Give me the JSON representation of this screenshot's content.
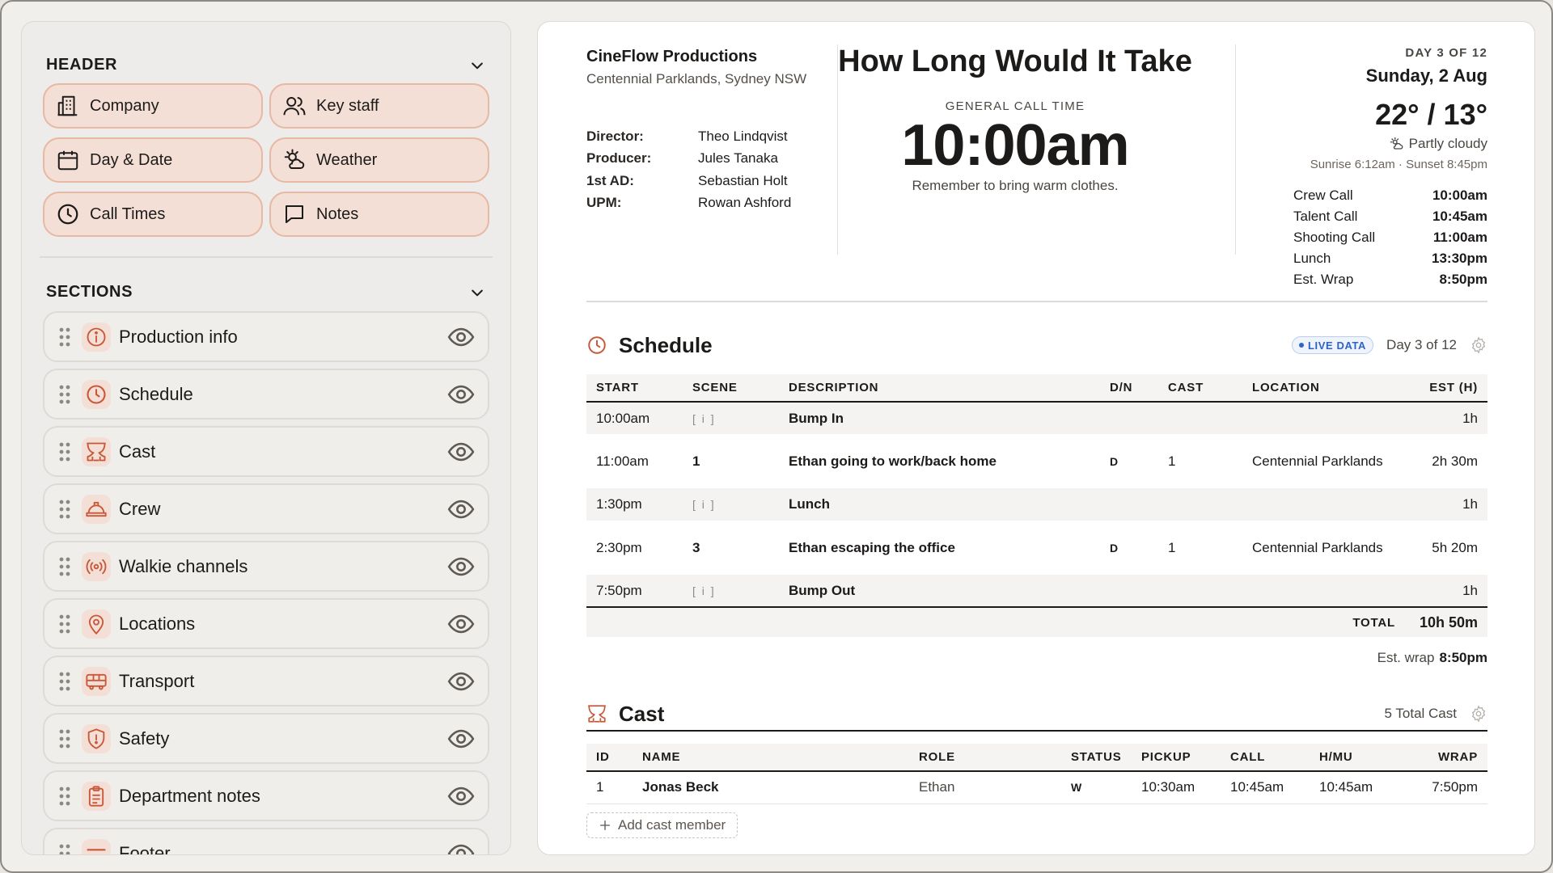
{
  "sidebar": {
    "header_title": "HEADER",
    "header_chips": [
      {
        "label": "Company",
        "icon": "building-icon"
      },
      {
        "label": "Key staff",
        "icon": "users-icon"
      },
      {
        "label": "Day & Date",
        "icon": "calendar-icon"
      },
      {
        "label": "Weather",
        "icon": "weather-icon"
      },
      {
        "label": "Call Times",
        "icon": "clock-icon"
      },
      {
        "label": "Notes",
        "icon": "message-icon"
      }
    ],
    "sections_title": "SECTIONS",
    "sections": [
      {
        "label": "Production info",
        "icon": "info-icon"
      },
      {
        "label": "Schedule",
        "icon": "clock-icon"
      },
      {
        "label": "Cast",
        "icon": "theater-icon"
      },
      {
        "label": "Crew",
        "icon": "hardhat-icon"
      },
      {
        "label": "Walkie channels",
        "icon": "radio-icon"
      },
      {
        "label": "Locations",
        "icon": "map-pin-icon"
      },
      {
        "label": "Transport",
        "icon": "bus-icon"
      },
      {
        "label": "Safety",
        "icon": "shield-icon"
      },
      {
        "label": "Department notes",
        "icon": "clipboard-icon"
      },
      {
        "label": "Footer",
        "icon": "footer-icon"
      }
    ]
  },
  "doc": {
    "company": "CineFlow Productions",
    "company_location": "Centennial Parklands, Sydney NSW",
    "staff": [
      {
        "role": "Director:",
        "name": "Theo Lindqvist"
      },
      {
        "role": "Producer:",
        "name": "Jules Tanaka"
      },
      {
        "role": "1st AD:",
        "name": "Sebastian Holt"
      },
      {
        "role": "UPM:",
        "name": "Rowan Ashford"
      }
    ],
    "title": "How Long Would It Take",
    "general_call_label": "GENERAL CALL TIME",
    "general_call_time": "10:00am",
    "general_call_note": "Remember to bring warm clothes.",
    "day_of": "DAY 3 OF 12",
    "date": "Sunday, 2 Aug",
    "temperature": "22° / 13°",
    "conditions": "Partly cloudy",
    "sun": "Sunrise 6:12am · Sunset 8:45pm",
    "call_times": [
      {
        "label": "Crew Call",
        "time": "10:00am"
      },
      {
        "label": "Talent Call",
        "time": "10:45am"
      },
      {
        "label": "Shooting Call",
        "time": "11:00am"
      },
      {
        "label": "Lunch",
        "time": "13:30pm"
      },
      {
        "label": "Est. Wrap",
        "time": "8:50pm"
      }
    ]
  },
  "schedule": {
    "title": "Schedule",
    "live_label": "LIVE DATA",
    "day_label": "Day 3 of 12",
    "columns": [
      "START",
      "SCENE",
      "DESCRIPTION",
      "D/N",
      "CAST",
      "LOCATION",
      "EST (H)"
    ],
    "rows": [
      {
        "start": "10:00am",
        "scene": "[ i ]",
        "desc": "Bump In",
        "dn": "",
        "cast": "",
        "location": "",
        "est": "1h",
        "kind": "gray"
      },
      {
        "start": "11:00am",
        "scene": "1",
        "desc": "Ethan going to work/back home",
        "dn": "D",
        "cast": "1",
        "location": "Centennial Parklands",
        "est": "2h 30m",
        "kind": "white"
      },
      {
        "start": "1:30pm",
        "scene": "[ i ]",
        "desc": "Lunch",
        "dn": "",
        "cast": "",
        "location": "",
        "est": "1h",
        "kind": "gray"
      },
      {
        "start": "2:30pm",
        "scene": "3",
        "desc": "Ethan escaping the office",
        "dn": "D",
        "cast": "1",
        "location": "Centennial Parklands",
        "est": "5h 20m",
        "kind": "white"
      },
      {
        "start": "7:50pm",
        "scene": "[ i ]",
        "desc": "Bump Out",
        "dn": "",
        "cast": "",
        "location": "",
        "est": "1h",
        "kind": "gray"
      }
    ],
    "total_label": "TOTAL",
    "total_value": "10h 50m",
    "est_wrap_label": "Est. wrap",
    "est_wrap_value": "8:50pm"
  },
  "cast": {
    "title": "Cast",
    "total_label": "5 Total Cast",
    "columns": [
      "ID",
      "NAME",
      "ROLE",
      "STATUS",
      "PICKUP",
      "CALL",
      "H/MU",
      "WRAP"
    ],
    "rows": [
      {
        "id": "1",
        "name": "Jonas Beck",
        "role": "Ethan",
        "status": "W",
        "pickup": "10:30am",
        "call": "10:45am",
        "hmu": "10:45am",
        "wrap": "7:50pm"
      }
    ],
    "add_label": "Add cast member"
  },
  "colors": {
    "accent": "#c7583a",
    "chip_bg": "#f3dfd5",
    "chip_border": "#e7b8a2",
    "live_blue": "#2f63c7"
  }
}
